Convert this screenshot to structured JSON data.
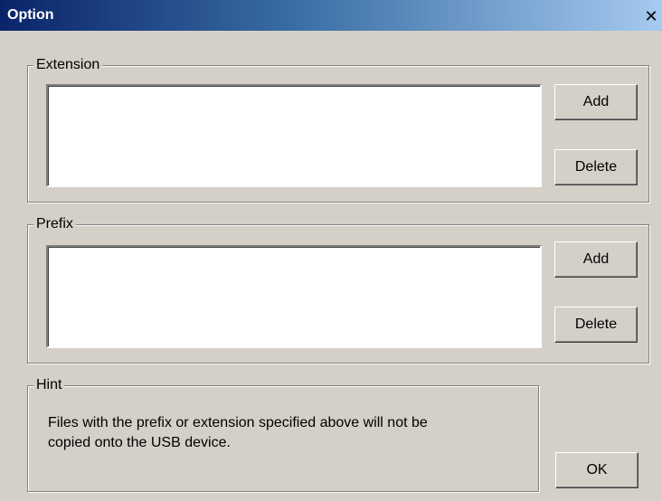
{
  "window": {
    "title": "Option",
    "close_glyph": "✕"
  },
  "extension": {
    "legend": "Extension",
    "items": [],
    "add_label": "Add",
    "delete_label": "Delete"
  },
  "prefix": {
    "legend": "Prefix",
    "items": [],
    "add_label": "Add",
    "delete_label": "Delete"
  },
  "hint": {
    "legend": "Hint",
    "line1": "Files with the prefix or extension specified above will not be",
    "line2": "copied onto the USB device."
  },
  "ok_label": "OK",
  "colors": {
    "dialog_bg": "#d4d0c8",
    "titlebar_start": "#0a246a",
    "titlebar_end": "#a6caf0"
  }
}
